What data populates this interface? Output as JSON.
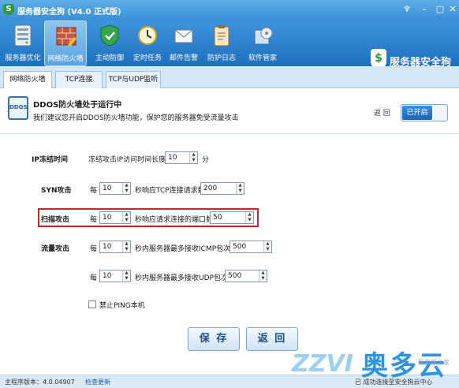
{
  "window": {
    "title": "服务器安全狗 (V4.0 正式版)",
    "controls": [
      "minimize",
      "maximize",
      "close"
    ]
  },
  "toolbar": {
    "items": [
      {
        "label": "服务器优化",
        "icon": "server-icon",
        "active": false
      },
      {
        "label": "网络防火墙",
        "icon": "firewall-icon",
        "active": true
      },
      {
        "label": "主动防御",
        "icon": "shield-icon",
        "active": false
      },
      {
        "label": "定时任务",
        "icon": "clock-icon",
        "active": false
      },
      {
        "label": "邮件告警",
        "icon": "mail-icon",
        "active": false
      },
      {
        "label": "防护日志",
        "icon": "clipboard-icon",
        "active": false
      },
      {
        "label": "软件管家",
        "icon": "package-icon",
        "active": false
      }
    ],
    "brand": "服务器安全狗"
  },
  "tabs": [
    {
      "label": "网络防火墙",
      "active": true
    },
    {
      "label": "TCP连接",
      "active": false
    },
    {
      "label": "TCP与UDP监听",
      "active": false
    }
  ],
  "status": {
    "icon_text": "DDOS",
    "title": "DDOS防火墙处于运行中",
    "subtitle": "我们建议您开启DDOS防火墙功能，保护您的服务器免受流量攻击",
    "back": "返 回",
    "toggle": "已开启"
  },
  "form": {
    "ip_freeze": {
      "label": "IP冻结时间",
      "prefix": "冻结攻击IP访问时间长度",
      "value": "10",
      "unit": "分"
    },
    "syn": {
      "label": "SYN攻击",
      "per": "每",
      "seconds": "10",
      "mid": "秒响应TCP连接请求数",
      "value": "200"
    },
    "scan": {
      "label": "扫描攻击",
      "per": "每",
      "seconds": "10",
      "mid": "秒响应请求连接的端口数",
      "value": "50"
    },
    "flood": {
      "label": "流量攻击",
      "per": "每",
      "seconds": "10",
      "mid": "秒内服务器最多接收ICMP包次数",
      "value": "500"
    },
    "flood_udp": {
      "per": "每",
      "seconds": "10",
      "mid": "秒内服务器最多接收UDP包次数",
      "value": "500"
    },
    "ping": {
      "label": "禁止PING本机",
      "checked": false
    },
    "save": "保 存",
    "back": "返 回"
  },
  "footer": {
    "version": "主程序版本：4.0.04907",
    "update": "检查更新",
    "connection": "已 成功连接至安全狗云中心"
  },
  "watermark": {
    "latin": "ZZVI",
    "cn": "奥多云",
    "small": "服务器之家"
  }
}
